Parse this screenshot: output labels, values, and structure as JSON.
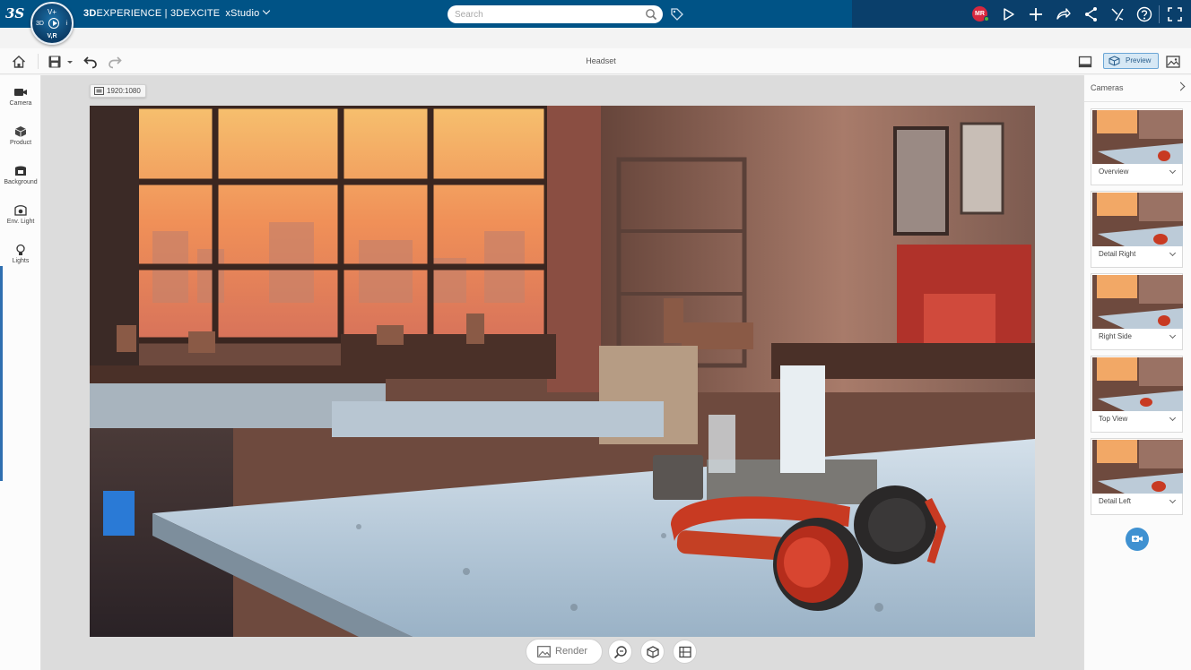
{
  "topbar": {
    "brand_bold": "3D",
    "brand_rest": "EXPERIENCE | 3DEXCITE",
    "app_name": "xStudio",
    "search_placeholder": "Search",
    "avatar_initials": "MR",
    "compass": {
      "top": "V+",
      "left": "3D",
      "right": "i",
      "bottom": "V,R"
    }
  },
  "toolbar": {
    "document_title": "Headset",
    "preview_label": "Preview"
  },
  "left_sidebar": {
    "items": [
      {
        "label": "Camera",
        "icon": "camera-icon"
      },
      {
        "label": "Product",
        "icon": "cube-icon"
      },
      {
        "label": "Background",
        "icon": "background-icon"
      },
      {
        "label": "Env. Light",
        "icon": "env-light-icon"
      },
      {
        "label": "Lights",
        "icon": "bulb-icon"
      }
    ]
  },
  "canvas": {
    "resolution": "1920:1080",
    "render_label": "Render"
  },
  "cameras_panel": {
    "title": "Cameras",
    "cameras": [
      {
        "label": "Overview"
      },
      {
        "label": "Detail Right"
      },
      {
        "label": "Right Side"
      },
      {
        "label": "Top View"
      },
      {
        "label": "Detail Left"
      }
    ]
  },
  "colors": {
    "topbar": "#005386",
    "topbar_right": "#0a3f6b",
    "accent_blue": "#3f91d1",
    "headphone_red": "#c83a22"
  }
}
